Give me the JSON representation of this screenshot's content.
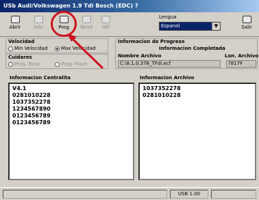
{
  "window": {
    "title": "USb Audi/Volkswagen 1.9 Tdi Bosch (EDC) ?"
  },
  "toolbar": {
    "buttons": [
      {
        "label": "Abrir",
        "icon": "open-folder-icon",
        "enabled": true
      },
      {
        "label": "Info",
        "icon": "info-icon",
        "enabled": false
      },
      {
        "label": "Prog",
        "icon": "program-chip-icon",
        "enabled": true
      },
      {
        "label": "Read",
        "icon": "read-icon",
        "enabled": false
      },
      {
        "label": "Off",
        "icon": "power-off-icon",
        "enabled": false
      },
      {
        "label": "Salir",
        "icon": "exit-icon",
        "enabled": true
      }
    ],
    "language_label": "Lengua",
    "language_value": "Espanol"
  },
  "velocidad": {
    "label": "Velocidad",
    "options": [
      "Min Velocidad",
      "Max Velocidad"
    ],
    "selected": "Max Velocidad"
  },
  "cuidados": {
    "label": "Cuidares",
    "options": [
      "Prog. Total",
      "Prog. Flash"
    ]
  },
  "progress_info": {
    "label": "Informacion de Progreso",
    "status": "Informacion Completada",
    "file_label": "Nombre Archivo",
    "file_value": "C:\\8.1.0.378_TFdi.ecf",
    "length_label": "Lon. Archivo",
    "length_value": "?817F"
  },
  "left_panel": {
    "label": "Informacion Centralita",
    "lines": [
      "V4.1",
      "0281010228",
      "1037352278",
      "1234567890",
      "0123456789",
      "0123456789"
    ]
  },
  "right_panel": {
    "label": "Informacion Archivo",
    "lines": [
      "1037352278",
      "0281010228"
    ]
  },
  "statusbar": {
    "value": "USB 1.00"
  },
  "colors": {
    "highlight_ring": "#d0101c",
    "title_bar": "#0a246a"
  }
}
